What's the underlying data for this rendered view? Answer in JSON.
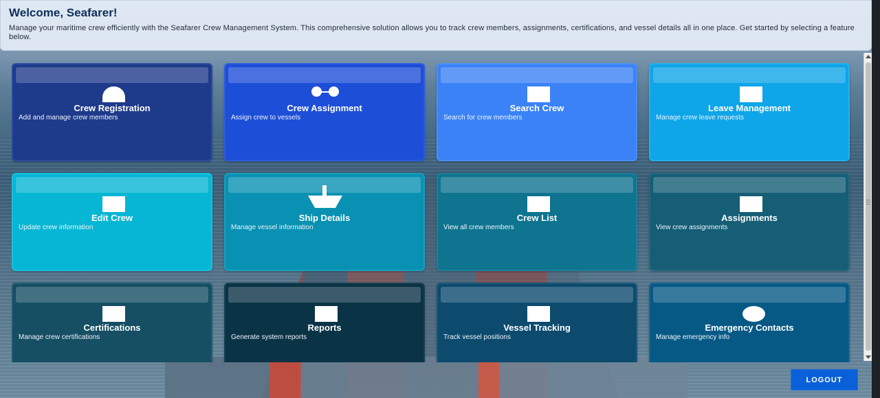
{
  "header": {
    "title": "Welcome, Seafarer!",
    "description": "Manage your maritime crew efficiently with the Seafarer Crew Management System. This comprehensive solution allows you to track crew members, assignments, certifications, and vessel details all in one place. Get started by selecting a feature below."
  },
  "cards": [
    {
      "title": "Crew Registration",
      "desc": "Add and manage crew members",
      "icon": "person-icon",
      "color": "#1e3a8a"
    },
    {
      "title": "Crew Assignment",
      "desc": "Assign crew to vessels",
      "icon": "link-icon",
      "color": "#1d4ed8"
    },
    {
      "title": "Search Crew",
      "desc": "Search for crew members",
      "icon": "search-icon",
      "color": "#3b82f6"
    },
    {
      "title": "Leave Management",
      "desc": "Manage crew leave requests",
      "icon": "calendar-icon",
      "color": "#0ea5e9"
    },
    {
      "title": "Edit Crew",
      "desc": "Update crew information",
      "icon": "edit-icon",
      "color": "#06b6d4"
    },
    {
      "title": "Ship Details",
      "desc": "Manage vessel information",
      "icon": "ship-icon",
      "color": "#0891b2"
    },
    {
      "title": "Crew List",
      "desc": "View all crew members",
      "icon": "list-icon",
      "color": "#0e7490"
    },
    {
      "title": "Assignments",
      "desc": "View crew assignments",
      "icon": "clipboard-icon",
      "color": "#155e75"
    },
    {
      "title": "Certifications",
      "desc": "Manage crew certifications",
      "icon": "certificate-icon",
      "color": "#164e63"
    },
    {
      "title": "Reports",
      "desc": "Generate system reports",
      "icon": "report-icon",
      "color": "#0b3346"
    },
    {
      "title": "Vessel Tracking",
      "desc": "Track vessel positions",
      "icon": "map-icon",
      "color": "#0c4a6e"
    },
    {
      "title": "Emergency Contacts",
      "desc": "Manage emergency info",
      "icon": "phone-icon",
      "color": "#075985"
    }
  ],
  "logout_label": "LOGOUT"
}
